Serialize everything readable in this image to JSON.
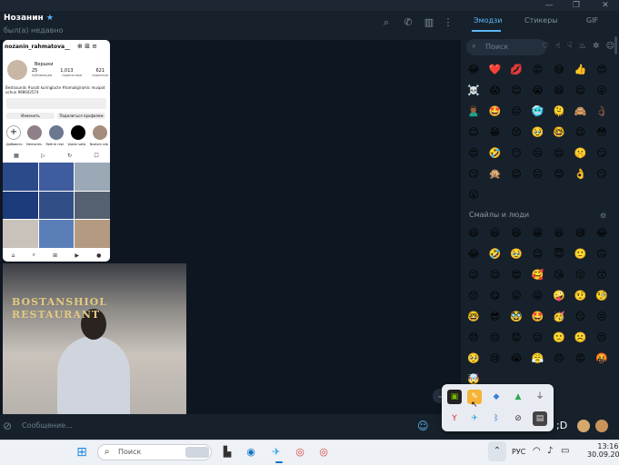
{
  "window": {
    "minimize": "—",
    "maximize": "❐",
    "close": "✕"
  },
  "chat": {
    "name": "Нозанин",
    "star": "★",
    "status": "был(а) недавно",
    "composer_placeholder": "Сообщение..."
  },
  "header_icons": [
    "search-icon",
    "phone-icon",
    "sidebar-icon",
    "more-icon"
  ],
  "emoji_panel": {
    "tabs": [
      "Эмодзи",
      "Стикеры",
      "GIF"
    ],
    "active_tab": "Эмодзи",
    "search_placeholder": "Поиск",
    "section_title": "Смайлы и люди",
    "recent": [
      "😂",
      "❤️",
      "💋",
      "😡",
      "😅",
      "👍",
      "😍",
      "☠️",
      "😱",
      "😊",
      "😭",
      "😄",
      "😌",
      "😜",
      "🙎🏾‍♂️",
      "🤩",
      "😑",
      "🥶",
      "🫠",
      "🙈",
      "👌🏿",
      "😊",
      "😁",
      "😚",
      "🥹",
      "🤓",
      "😉",
      "😳",
      "😍",
      "🤣",
      "😶",
      "😑",
      "😌",
      "🤫",
      "😏",
      "😏",
      "🙊",
      "😌",
      "😐",
      "😊",
      "👌",
      "😏",
      "😮"
    ],
    "smileys": [
      "😄",
      "😃",
      "😄",
      "😁",
      "😆",
      "😅",
      "😂",
      "😂",
      "🤣",
      "🥹",
      "😊",
      "😇",
      "🙂",
      "🙃",
      "😉",
      "😌",
      "😍",
      "🥰",
      "😘",
      "😗",
      "😙",
      "😚",
      "😋",
      "😛",
      "😜",
      "🤪",
      "🤨",
      "🧐",
      "🤓",
      "😎",
      "🥸",
      "🤩",
      "🥳",
      "😏",
      "😒",
      "😞",
      "😔",
      "😟",
      "😕",
      "🙁",
      "☹️",
      "😣",
      "🥺",
      "😢",
      "😭",
      "😤",
      "😠",
      "😡",
      "🤬",
      "🤯"
    ]
  },
  "chat_content": {
    "profile_username": "nozanin_rahmatova__",
    "profile_stats": [
      {
        "v": "25",
        "l": "публикации"
      },
      {
        "v": "1,013",
        "l": "подписчики"
      },
      {
        "v": "621",
        "l": "подписки"
      }
    ],
    "profile_name": "Вершки",
    "profile_bio": "Bestsounds #usoti kuringlacte #tomailgiramic muspot uchun 998042574",
    "profile_btn_edit": "Изменить",
    "profile_btn_share": "Поделиться профилем",
    "highlights": [
      "Добавить",
      "Nemories",
      "Retirre real",
      "Vazlar salla",
      "Nozlam sila"
    ],
    "photo_text": "BOSTANSHIOL RESTAURANT"
  },
  "tray": {
    "icons": [
      "nvidia-icon",
      "notepad-icon",
      "cube-icon",
      "drive-icon",
      "usb-icon",
      "yandex-icon",
      "telegram-icon",
      "bluetooth-icon",
      "hidden-icon",
      "monitor-icon"
    ]
  },
  "taskbar": {
    "search_placeholder": "Поиск",
    "lang": "РУС",
    "time": "13:16",
    "date": "30.09.2025",
    "chevron": "⌃"
  },
  "colors": {
    "accent": "#5eb5f7",
    "panel_bg": "#17212b",
    "chat_bg": "#0e1621"
  }
}
